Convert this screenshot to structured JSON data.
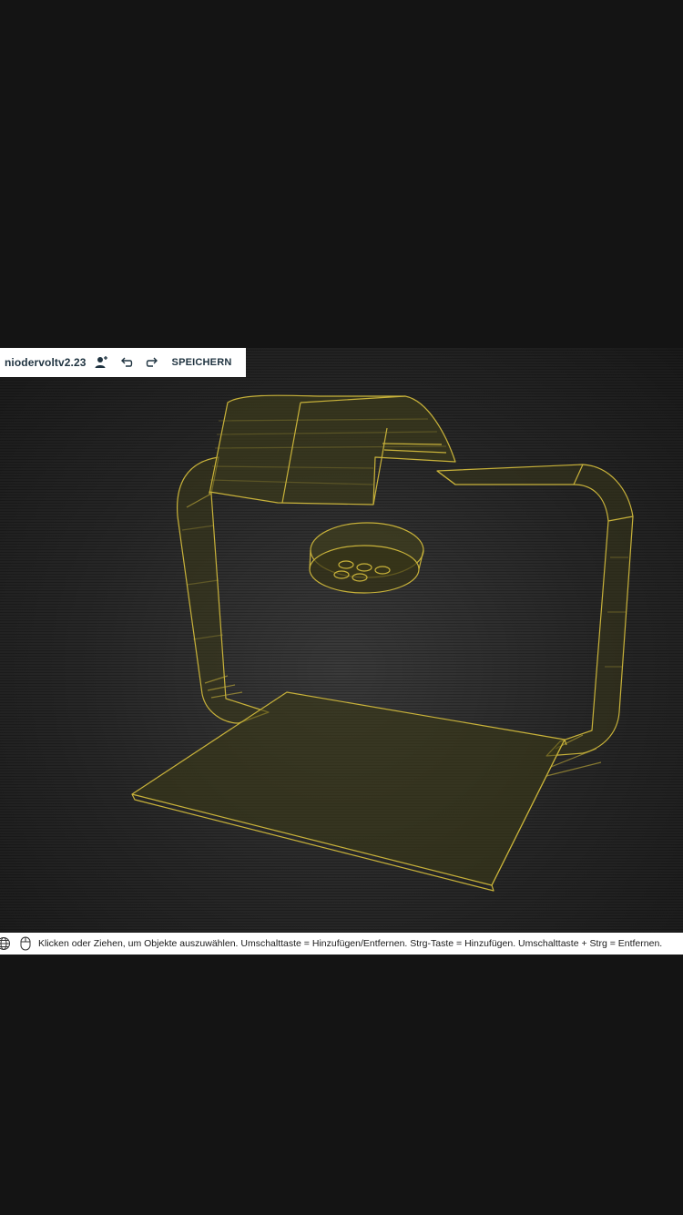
{
  "toolbar": {
    "model_name": "niodervoltv2.23",
    "user_icon": "user-add-icon",
    "undo_icon": "undo-icon",
    "redo_icon": "redo-icon",
    "save_label": "SPEICHERN"
  },
  "statusbar": {
    "globe_icon": "globe-icon",
    "mouse_icon": "mouse-icon",
    "hint": "Klicken oder Ziehen, um Objekte auszuwählen. Umschalttaste = Hinzufügen/Entfernen. Strg-Taste = Hinzufügen. Umschalttaste + Strg = Entfernen."
  },
  "colors": {
    "wireframe": "#c8b23a",
    "fill": "#3a3818",
    "background": "#141414",
    "toolbar_text": "#1f3340"
  }
}
